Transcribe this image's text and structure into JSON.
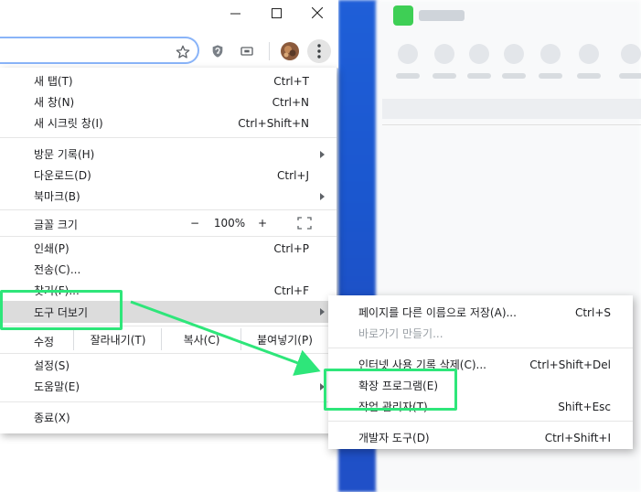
{
  "window": {
    "minimize_icon": "minimize-icon",
    "maximize_icon": "maximize-icon",
    "close_icon": "close-icon"
  },
  "toolbar": {
    "star_icon": "bookmark-star-icon",
    "ext1_icon": "shield-extension-icon",
    "ext2_icon": "cast-extension-icon",
    "avatar": "profile-avatar",
    "menu_icon": "kebab-menu-icon"
  },
  "menu": {
    "new_tab": {
      "label": "새 탭(T)",
      "shortcut": "Ctrl+T"
    },
    "new_window": {
      "label": "새 창(N)",
      "shortcut": "Ctrl+N"
    },
    "new_incognito": {
      "label": "새 시크릿 창(I)",
      "shortcut": "Ctrl+Shift+N"
    },
    "history": {
      "label": "방문 기록(H)"
    },
    "downloads": {
      "label": "다운로드(D)",
      "shortcut": "Ctrl+J"
    },
    "bookmarks": {
      "label": "북마크(B)"
    },
    "zoom": {
      "label": "글꼴 크기",
      "minus": "−",
      "value": "100%",
      "plus": "+"
    },
    "print": {
      "label": "인쇄(P)",
      "shortcut": "Ctrl+P"
    },
    "cast": {
      "label": "전송(C)..."
    },
    "find": {
      "label": "찾기(F)...",
      "shortcut": "Ctrl+F"
    },
    "more_tools": {
      "label": "도구 더보기"
    },
    "edit": {
      "label": "수정",
      "cut": "잘라내기(T)",
      "copy": "복사(C)",
      "paste": "붙여넣기(P)"
    },
    "settings": {
      "label": "설정(S)"
    },
    "help": {
      "label": "도움말(E)"
    },
    "exit": {
      "label": "종료(X)"
    }
  },
  "submenu": {
    "save_page": {
      "label": "페이지를 다른 이름으로 저장(A)...",
      "shortcut": "Ctrl+S"
    },
    "create_shortcut": {
      "label": "바로가기 만들기..."
    },
    "clear_data": {
      "label": "인터넷 사용 기록 삭제(C)...",
      "shortcut": "Ctrl+Shift+Del"
    },
    "extensions": {
      "label": "확장 프로그램(E)"
    },
    "task_manager": {
      "label": "작업 관리자(T)",
      "shortcut": "Shift+Esc"
    },
    "dev_tools": {
      "label": "개발자 도구(D)",
      "shortcut": "Ctrl+Shift+I"
    }
  },
  "colors": {
    "annotation": "#2ee67a",
    "highlight": "#dcdcdc",
    "blue_strip": "#1f5fd8"
  }
}
